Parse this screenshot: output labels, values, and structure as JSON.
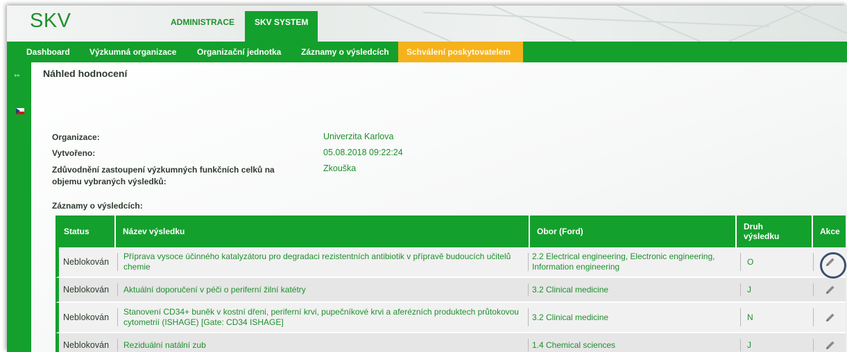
{
  "app": {
    "logo": "SKV",
    "top_tabs": [
      {
        "label": "ADMINISTRACE",
        "active": false
      },
      {
        "label": "SKV SYSTEM",
        "active": true
      }
    ]
  },
  "nav": {
    "items": [
      {
        "label": "Dashboard",
        "active": false
      },
      {
        "label": "Výzkumná organizace",
        "active": false
      },
      {
        "label": "Organizační jednotka",
        "active": false
      },
      {
        "label": "Záznamy o výsledcích",
        "active": false
      },
      {
        "label": "Schválení poskytovatelem",
        "active": true
      }
    ]
  },
  "sidebar": {
    "icons": [
      "expand-arrows-icon",
      "czech-flag-icon"
    ]
  },
  "page": {
    "title": "Náhled hodnocení",
    "info": [
      {
        "label": "Organizace:",
        "value": "Univerzita Karlova"
      },
      {
        "label": "Vytvořeno:",
        "value": "05.08.2018 09:22:24"
      },
      {
        "label": "Zdůvodnění zastoupení výzkumných funkčních celků na objemu vybraných výsledků:",
        "value": "Zkouška"
      }
    ],
    "section_title": "Záznamy o výsledcích:"
  },
  "table": {
    "headers": {
      "status": "Status",
      "name": "Název výsledku",
      "obor": "Obor (Ford)",
      "druh": "Druh výsledku",
      "akce": "Akce"
    },
    "rows": [
      {
        "status": "Neblokován",
        "name": "Příprava vysoce účinného katalyzátoru pro degradaci rezistentních antibiotik v přípravě budoucích učitelů chemie",
        "obor": "2.2 Electrical engineering, Electronic engineering, Information engineering",
        "druh": "O",
        "action_icon": "pencil-icon"
      },
      {
        "status": "Neblokován",
        "name": "Aktuální doporučení v péči o periferní žilní katétry",
        "obor": "3.2 Clinical medicine",
        "druh": "J",
        "action_icon": "pencil-icon"
      },
      {
        "status": "Neblokován",
        "name": "Stanovení CD34+ buněk v kostní dřeni, periferní krvi, pupečníkové krvi a aferézních produktech průtokovou cytometrií (ISHAGE) [Gate: CD34 ISHAGE]",
        "obor": "3.2 Clinical medicine",
        "druh": "N",
        "action_icon": "pencil-icon"
      },
      {
        "status": "Neblokován",
        "name": "Reziduální natální zub",
        "obor": "1.4 Chemical sciences",
        "druh": "J",
        "action_icon": "pencil-icon"
      }
    ]
  },
  "colors": {
    "brand_green": "#14a02c",
    "link_green": "#1f8f2e",
    "active_orange": "#f6b21b",
    "highlight_circle": "#3a4f6e"
  }
}
